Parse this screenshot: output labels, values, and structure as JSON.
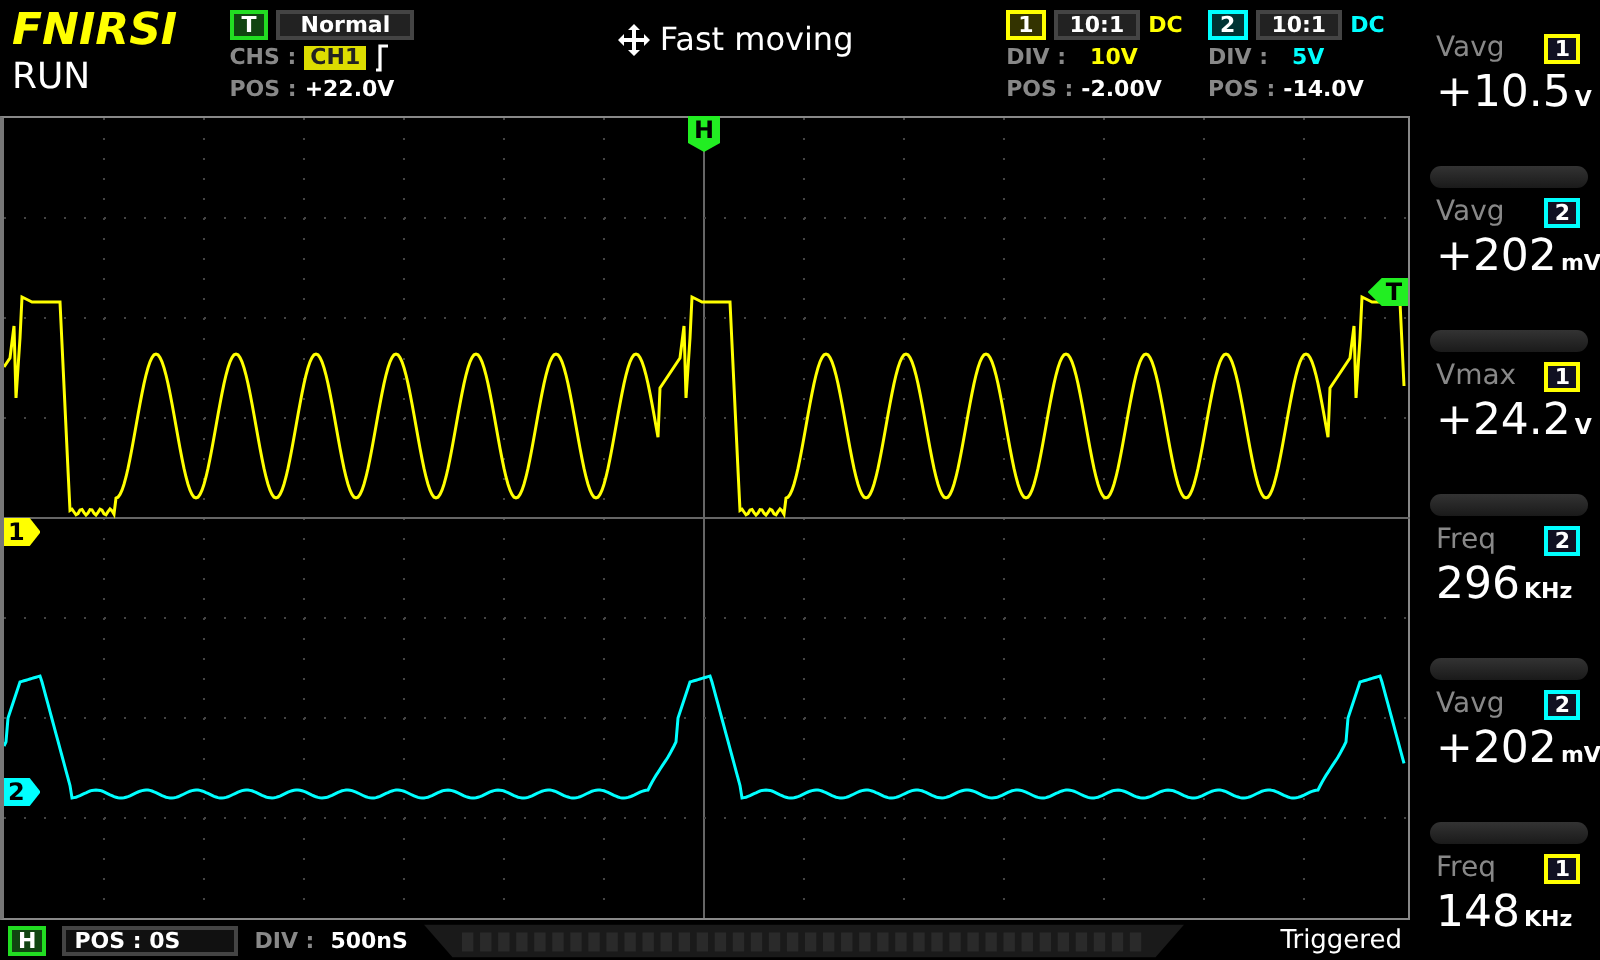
{
  "header": {
    "brand": "FNIRSI",
    "status": "RUN",
    "mode_hint": "Fast moving"
  },
  "trigger": {
    "badge": "T",
    "mode": "Normal",
    "source_label": "CHS :",
    "source": "CH1",
    "pos_label": "POS :",
    "pos": "+22.0V"
  },
  "channels": [
    {
      "number": "1",
      "probe": "10:1",
      "coupling": "DC",
      "div_label": "DIV :",
      "div": "10V",
      "pos_label": "POS :",
      "pos": "-2.00V",
      "color": "#ffff00"
    },
    {
      "number": "2",
      "probe": "10:1",
      "coupling": "DC",
      "div_label": "DIV :",
      "div": "5V",
      "pos_label": "POS :",
      "pos": "-14.0V",
      "color": "#00ffff"
    }
  ],
  "plot": {
    "markers": {
      "horizontal": "H",
      "trigger": "T",
      "channel_1": "1",
      "channel_2": "2"
    }
  },
  "measurements": [
    {
      "label": "Vavg",
      "channel": "1",
      "color": "#ffff00",
      "sign": "+",
      "value": "10.5",
      "unit": "V"
    },
    {
      "label": "Vavg",
      "channel": "2",
      "color": "#00ffff",
      "sign": "+",
      "value": "202",
      "unit": "mV"
    },
    {
      "label": "Vmax",
      "channel": "1",
      "color": "#ffff00",
      "sign": "+",
      "value": "24.2",
      "unit": "V"
    },
    {
      "label": "Freq",
      "channel": "2",
      "color": "#00ffff",
      "value": "296",
      "unit": "KHz"
    },
    {
      "label": "Vavg",
      "channel": "2",
      "color": "#00ffff",
      "sign": "+",
      "value": "202",
      "unit": "mV"
    },
    {
      "label": "Freq",
      "channel": "1",
      "color": "#ffff00",
      "value": "148",
      "unit": "KHz"
    }
  ],
  "timebase": {
    "badge": "H",
    "pos": "POS : 0S",
    "div_label": "DIV :",
    "div": "500nS",
    "status": "Triggered"
  }
}
